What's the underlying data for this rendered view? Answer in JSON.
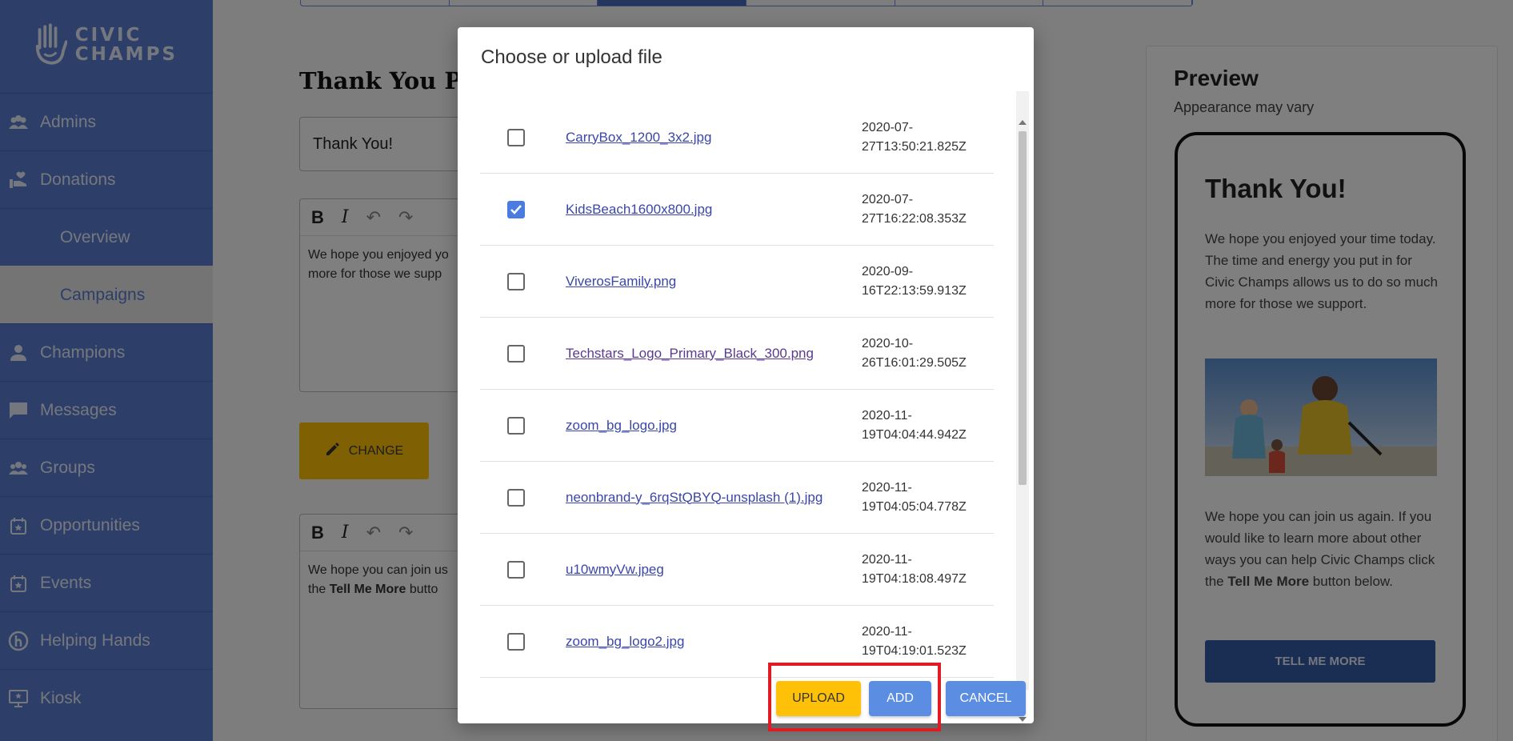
{
  "sidebar": {
    "logo_line1": "CIVIC",
    "logo_line2": "CHAMPS",
    "items": [
      {
        "label": "Admins",
        "icon": "people-icon"
      },
      {
        "label": "Donations",
        "icon": "donate-hand-icon"
      },
      {
        "label": "Overview"
      },
      {
        "label": "Campaigns"
      },
      {
        "label": "Champions",
        "icon": "person-icon"
      },
      {
        "label": "Messages",
        "icon": "message-icon"
      },
      {
        "label": "Groups",
        "icon": "group-icon"
      },
      {
        "label": "Opportunities",
        "icon": "calendar-star-icon"
      },
      {
        "label": "Events",
        "icon": "calendar-star-icon"
      },
      {
        "label": "Helping Hands",
        "icon": "helping-hands-icon"
      },
      {
        "label": "Kiosk",
        "icon": "kiosk-icon"
      }
    ]
  },
  "main": {
    "title": "Thank You Pro",
    "title_field_value": "Thank You!",
    "editor1_text": "We hope you enjoyed yo",
    "editor1_text2": "more for those we supp",
    "change_label": "CHANGE",
    "editor2_text": "We hope you can join us",
    "editor2_text2_pre": "the ",
    "editor2_bold": "Tell Me More",
    "editor2_text2_post": " butto"
  },
  "preview": {
    "title": "Preview",
    "subtitle": "Appearance may vary",
    "phone_title": "Thank You!",
    "phone_body": "We hope you enjoyed your time today. The time and energy you put in for Civic Champs allows us to do so much more for those we support.",
    "phone_body2_pre": "We hope you can join us again. If you would like to learn more about other ways you can help Civic Champs click the ",
    "phone_body2_bold": "Tell Me More",
    "phone_body2_post": " button below.",
    "phone_button": "TELL ME MORE"
  },
  "modal": {
    "title": "Choose or upload file",
    "files": [
      {
        "name": "CarryBox_1200_3x2.jpg",
        "date_line1": "2020-07-",
        "date_line2": "27T13:50:21.825Z",
        "checked": false
      },
      {
        "name": "KidsBeach1600x800.jpg",
        "date_line1": "2020-07-",
        "date_line2": "27T16:22:08.353Z",
        "checked": true
      },
      {
        "name": "ViverosFamily.png",
        "date_line1": "2020-09-",
        "date_line2": "16T22:13:59.913Z",
        "checked": false
      },
      {
        "name": "Techstars_Logo_Primary_Black_300.png",
        "date_line1": "2020-10-",
        "date_line2": "26T16:01:29.505Z",
        "checked": false
      },
      {
        "name": "zoom_bg_logo.jpg",
        "date_line1": "2020-11-",
        "date_line2": "19T04:04:44.942Z",
        "checked": false
      },
      {
        "name": "neonbrand-y_6rqStQBYQ-unsplash (1).jpg",
        "date_line1": "2020-11-",
        "date_line2": "19T04:05:04.778Z",
        "checked": false
      },
      {
        "name": "u10wmyVw.jpeg",
        "date_line1": "2020-11-",
        "date_line2": "19T04:18:08.497Z",
        "checked": false
      },
      {
        "name": "zoom_bg_logo2.jpg",
        "date_line1": "2020-11-",
        "date_line2": "19T04:19:01.523Z",
        "checked": false
      }
    ],
    "upload_label": "UPLOAD",
    "add_label": "ADD",
    "cancel_label": "CANCEL"
  },
  "colors": {
    "sidebar": "#5b7fd1",
    "accent_yellow": "#ffc107",
    "button_blue": "#5b8de3",
    "highlight_red": "#e01b24"
  }
}
